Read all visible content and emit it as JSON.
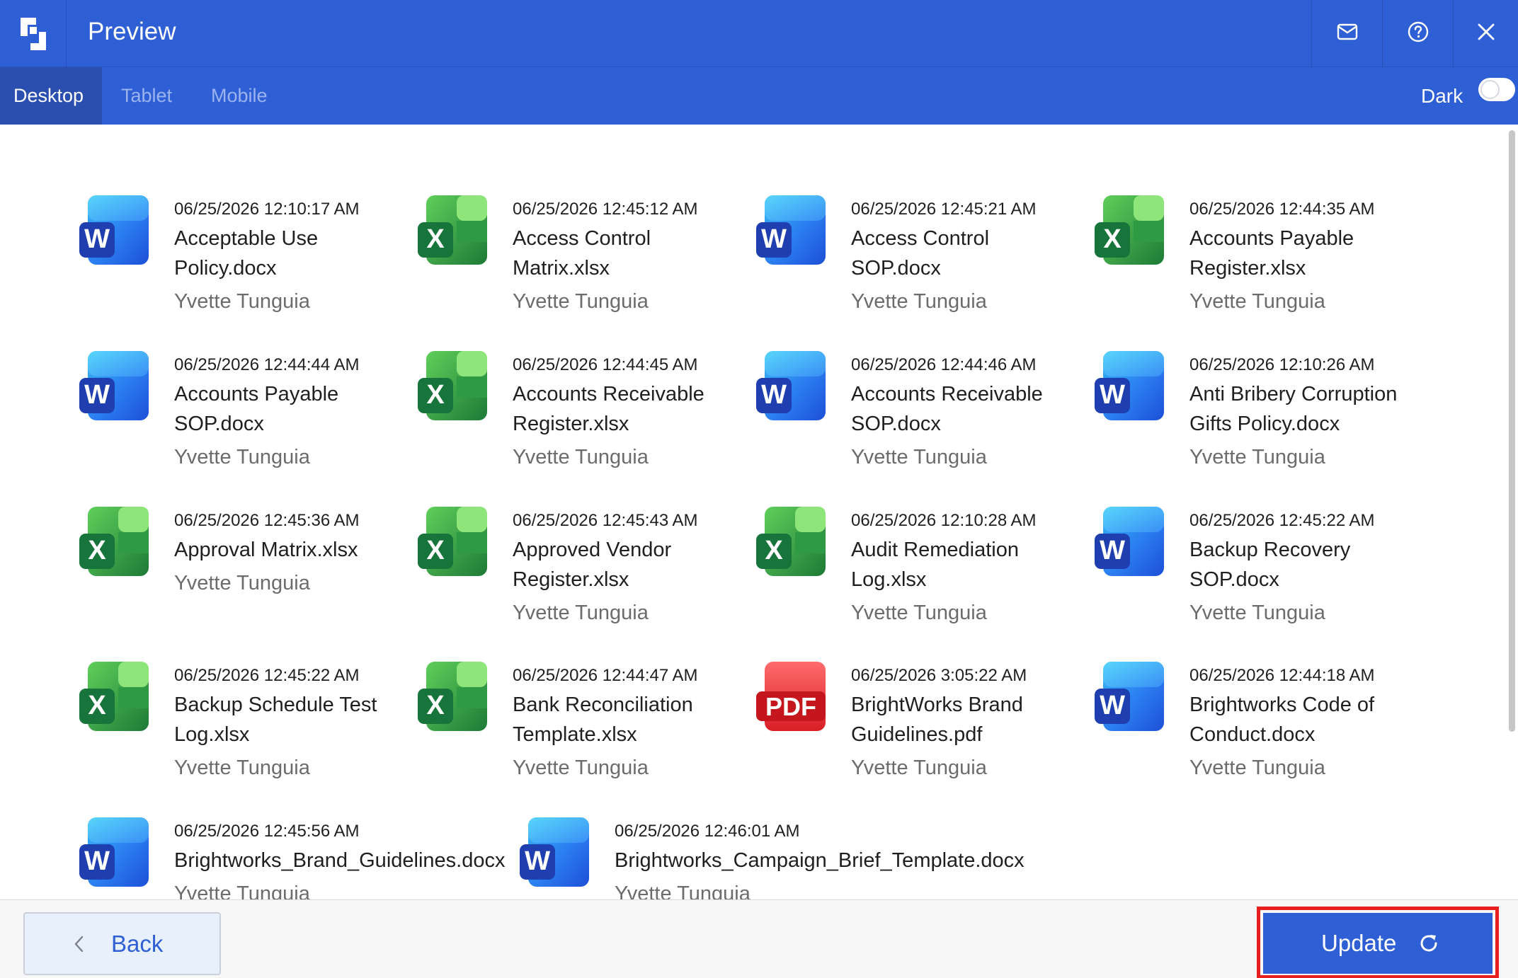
{
  "header": {
    "title": "Preview",
    "icons": {
      "logo": "app-logo-icon",
      "mail": "mail-icon",
      "help": "help-icon",
      "close": "close-icon"
    }
  },
  "tabs": [
    {
      "label": "Desktop",
      "active": true
    },
    {
      "label": "Tablet",
      "active": false
    },
    {
      "label": "Mobile",
      "active": false
    }
  ],
  "dark_mode": {
    "label": "Dark",
    "enabled": false
  },
  "files": [
    {
      "type": "word",
      "date": "06/25/2026 12:10:17 AM",
      "name_lines": [
        "Acceptable Use",
        "Policy.docx"
      ],
      "owner": "Yvette Tunguia"
    },
    {
      "type": "excel",
      "date": "06/25/2026 12:45:12 AM",
      "name_lines": [
        "Access Control",
        "Matrix.xlsx"
      ],
      "owner": "Yvette Tunguia"
    },
    {
      "type": "word",
      "date": "06/25/2026 12:45:21 AM",
      "name_lines": [
        "Access Control",
        "SOP.docx"
      ],
      "owner": "Yvette Tunguia"
    },
    {
      "type": "excel",
      "date": "06/25/2026 12:44:35 AM",
      "name_lines": [
        "Accounts Payable",
        "Register.xlsx"
      ],
      "owner": "Yvette Tunguia"
    },
    {
      "type": "word",
      "date": "06/25/2026 12:44:44 AM",
      "name_lines": [
        "Accounts Payable",
        "SOP.docx"
      ],
      "owner": "Yvette Tunguia"
    },
    {
      "type": "excel",
      "date": "06/25/2026 12:44:45 AM",
      "name_lines": [
        "Accounts Receivable",
        "Register.xlsx"
      ],
      "owner": "Yvette Tunguia"
    },
    {
      "type": "word",
      "date": "06/25/2026 12:44:46 AM",
      "name_lines": [
        "Accounts Receivable",
        "SOP.docx"
      ],
      "owner": "Yvette Tunguia"
    },
    {
      "type": "word",
      "date": "06/25/2026 12:10:26 AM",
      "name_lines": [
        "Anti Bribery Corruption",
        "Gifts Policy.docx"
      ],
      "owner": "Yvette Tunguia"
    },
    {
      "type": "excel",
      "date": "06/25/2026 12:45:36 AM",
      "name_lines": [
        "Approval Matrix.xlsx"
      ],
      "owner": "Yvette Tunguia"
    },
    {
      "type": "excel",
      "date": "06/25/2026 12:45:43 AM",
      "name_lines": [
        "Approved Vendor",
        "Register.xlsx"
      ],
      "owner": "Yvette Tunguia"
    },
    {
      "type": "excel",
      "date": "06/25/2026 12:10:28 AM",
      "name_lines": [
        "Audit Remediation",
        "Log.xlsx"
      ],
      "owner": "Yvette Tunguia"
    },
    {
      "type": "word",
      "date": "06/25/2026 12:45:22 AM",
      "name_lines": [
        "Backup Recovery",
        "SOP.docx"
      ],
      "owner": "Yvette Tunguia"
    },
    {
      "type": "excel",
      "date": "06/25/2026 12:45:22 AM",
      "name_lines": [
        "Backup Schedule Test",
        "Log.xlsx"
      ],
      "owner": "Yvette Tunguia"
    },
    {
      "type": "excel",
      "date": "06/25/2026 12:44:47 AM",
      "name_lines": [
        "Bank Reconciliation",
        "Template.xlsx"
      ],
      "owner": "Yvette Tunguia"
    },
    {
      "type": "pdf",
      "date": "06/25/2026 3:05:22 AM",
      "name_lines": [
        "BrightWorks Brand",
        "Guidelines.pdf"
      ],
      "owner": "Yvette Tunguia"
    },
    {
      "type": "word",
      "date": "06/25/2026 12:44:18 AM",
      "name_lines": [
        "Brightworks Code of",
        "Conduct.docx"
      ],
      "owner": "Yvette Tunguia"
    },
    {
      "type": "word",
      "date": "06/25/2026 12:45:56 AM",
      "name_lines": [
        "Brightworks_Brand_Guidelines.docx"
      ],
      "owner": "Yvette Tunguia"
    },
    {
      "type": "word",
      "date": "06/25/2026 12:46:01 AM",
      "name_lines": [
        "Brightworks_Campaign_Brief_Template.docx"
      ],
      "owner": "Yvette Tunguia"
    }
  ],
  "icon_letters": {
    "word": "W",
    "excel": "X",
    "pdf": "PDF"
  },
  "footer": {
    "back_label": "Back",
    "update_label": "Update",
    "icons": {
      "back": "chevron-left-icon",
      "update": "refresh-icon"
    }
  },
  "colors": {
    "brand": "#2f5fd4",
    "highlight": "#e81f1f"
  }
}
